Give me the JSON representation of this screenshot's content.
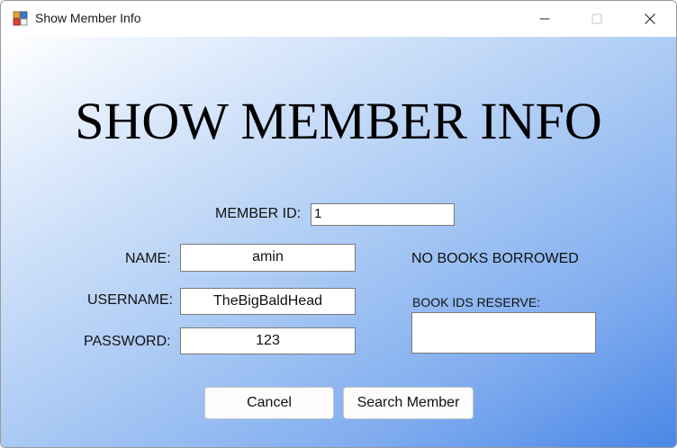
{
  "window": {
    "title": "Show Member Info",
    "controls": {
      "minimize": "minimize-icon",
      "maximize": "maximize-icon",
      "close": "close-icon"
    }
  },
  "heading": "SHOW MEMBER INFO",
  "form": {
    "member_id_label": "MEMBER ID:",
    "member_id_value": "1",
    "name_label": "NAME:",
    "name_value": "amin",
    "username_label": "USERNAME:",
    "username_value": "TheBigBaldHead",
    "password_label": "PASSWORD:",
    "password_value": "123",
    "borrow_status": "NO BOOKS BORROWED",
    "book_ids_label": "BOOK IDS RESERVE:"
  },
  "buttons": {
    "cancel": "Cancel",
    "search": "Search Member"
  },
  "colors": {
    "gradient_start": "#ffffff",
    "gradient_end": "#4a87e6"
  }
}
